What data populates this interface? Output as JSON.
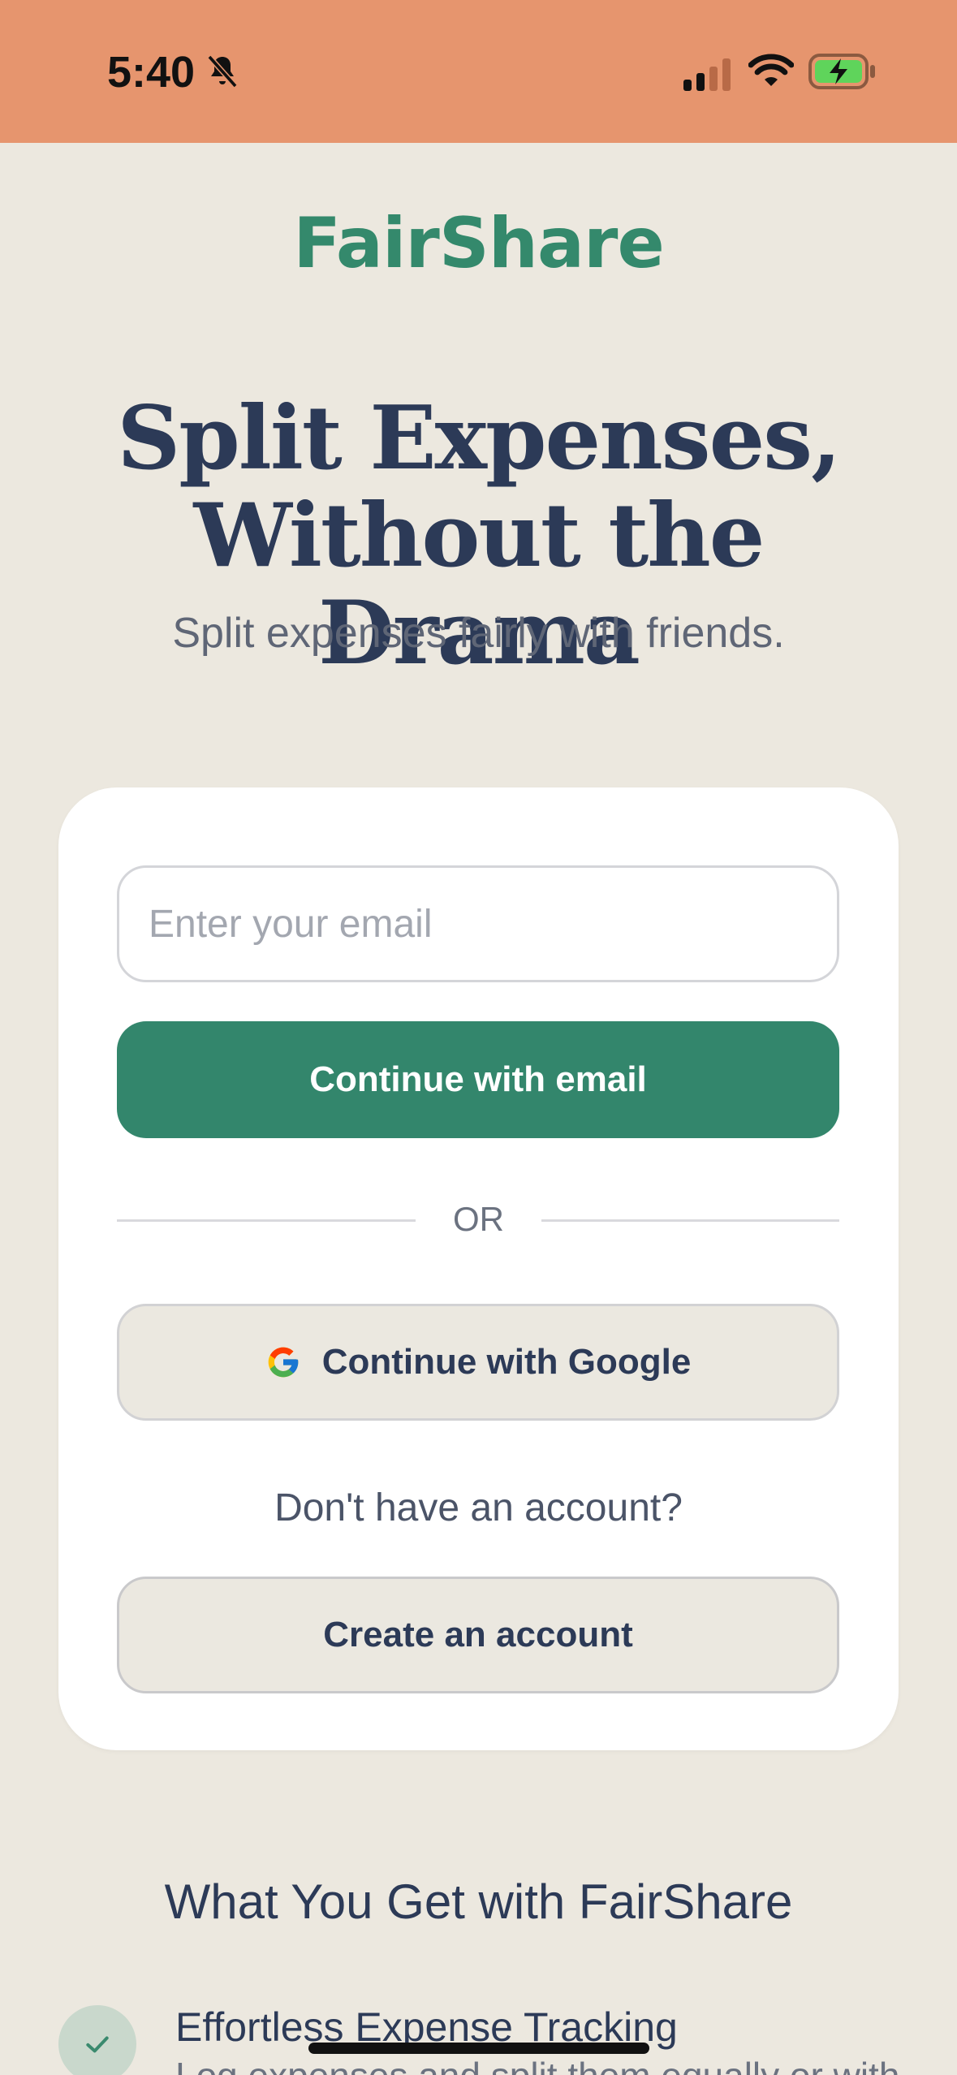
{
  "status_bar": {
    "time": "5:40",
    "background": "#E6956E",
    "icons": [
      "bell-slash-icon",
      "cellular-signal-icon",
      "wifi-icon",
      "battery-charging-icon"
    ]
  },
  "brand": {
    "name": "FairShare",
    "color": "#34896C"
  },
  "hero": {
    "title": "Split Expenses, Without the Drama",
    "subtitle": "Split expenses fairly with friends."
  },
  "auth_card": {
    "email_placeholder": "Enter your email",
    "email_value": "",
    "continue_email_label": "Continue with email",
    "divider_label": "OR",
    "google_label": "Continue with Google",
    "no_account_text": "Don't have an account?",
    "create_account_label": "Create an account",
    "accent_color": "#33866C"
  },
  "features": {
    "heading": "What You Get with FairShare",
    "items": [
      {
        "title": "Effortless Expense Tracking",
        "description": "Log expenses and split them equally or with"
      }
    ]
  }
}
